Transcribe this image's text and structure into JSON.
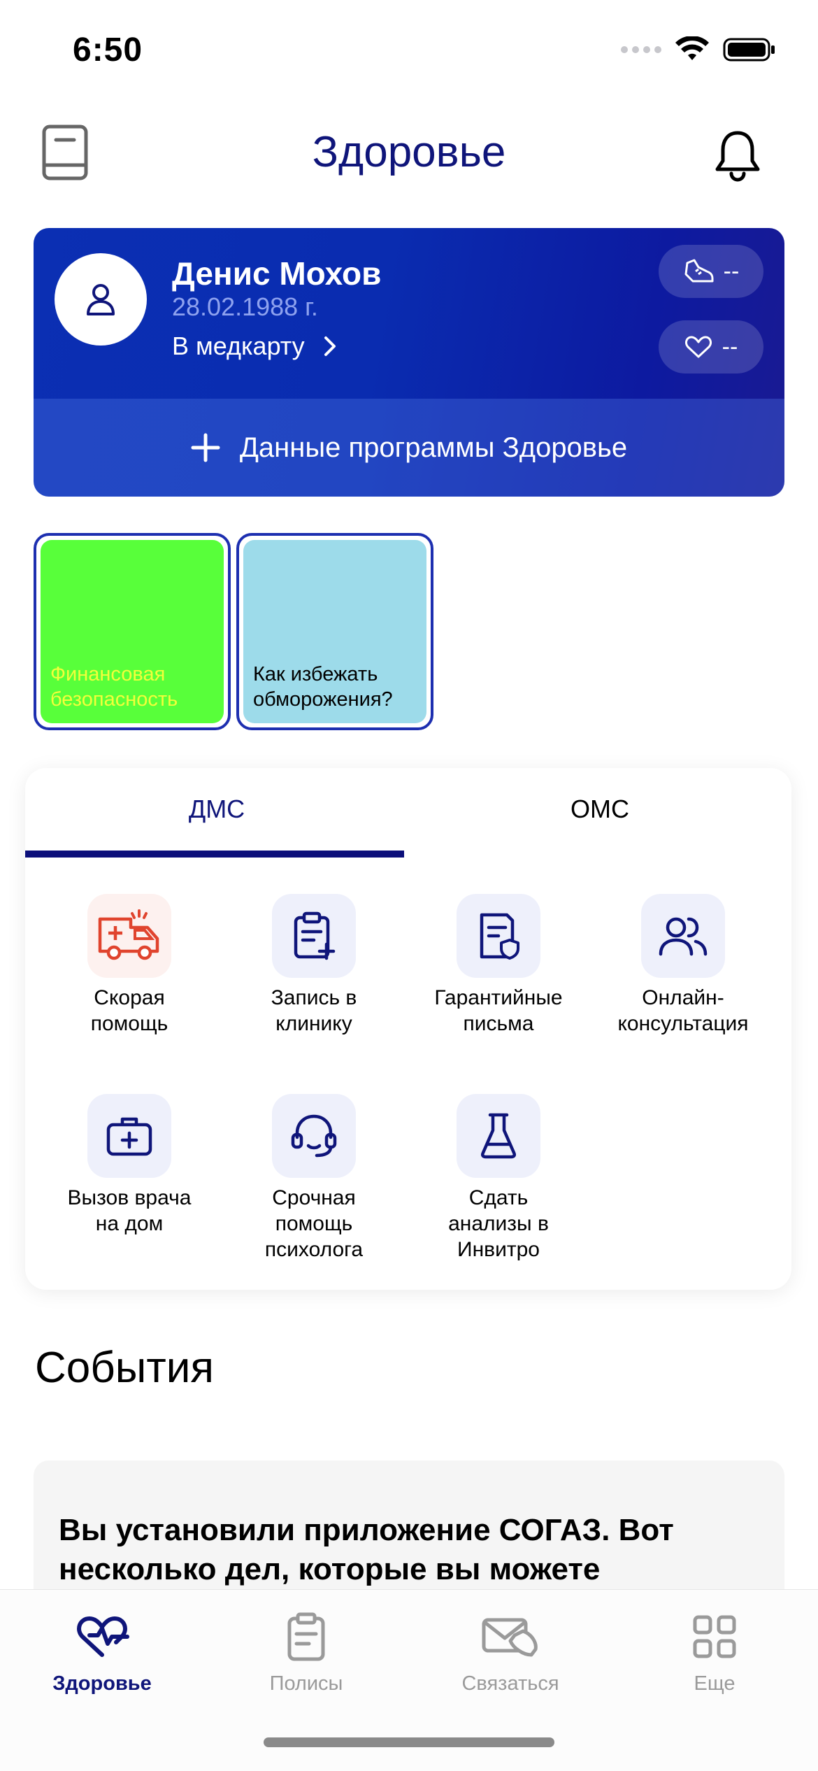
{
  "status_bar": {
    "time": "6:50"
  },
  "header": {
    "title": "Здоровье",
    "left_icon": "book-icon",
    "right_icon": "bell-icon"
  },
  "profile": {
    "name": "Денис Мохов",
    "dob": "28.02.1988 г.",
    "medcard_link": "В медкарту",
    "steps_value": "--",
    "heart_value": "--",
    "add_program_label": "Данные программы Здоровье"
  },
  "stories": [
    {
      "text": "Финансовая безопасность",
      "bg": "#58ff3a",
      "text_color": "#f2ff3a"
    },
    {
      "text": "Как избежать обморожения?",
      "bg": "#9ddbea",
      "text_color": "#000000"
    }
  ],
  "services": {
    "tabs": [
      {
        "label": "ДМС",
        "active": true
      },
      {
        "label": "ОМС",
        "active": false
      }
    ],
    "items": [
      {
        "label": "Скорая помощь",
        "icon": "ambulance-icon"
      },
      {
        "label": "Запись в клинику",
        "icon": "clipboard-plus-icon"
      },
      {
        "label": "Гарантийные письма",
        "icon": "document-shield-icon"
      },
      {
        "label": "Онлайн-консультация",
        "icon": "users-icon"
      },
      {
        "label": "Вызов врача на дом",
        "icon": "medkit-icon"
      },
      {
        "label": "Срочная помощь психолога",
        "icon": "headset-icon"
      },
      {
        "label": "Сдать анализы в Инвитро",
        "icon": "flask-icon"
      }
    ]
  },
  "events": {
    "title": "События",
    "card_text": "Вы установили приложение СОГАЗ. Вот несколько дел, которые вы можете"
  },
  "tab_bar": [
    {
      "label": "Здоровье",
      "icon": "heart-pulse-icon",
      "active": true
    },
    {
      "label": "Полисы",
      "icon": "clipboard-icon",
      "active": false
    },
    {
      "label": "Связаться",
      "icon": "mail-phone-icon",
      "active": false
    },
    {
      "label": "Еще",
      "icon": "grid-icon",
      "active": false
    }
  ],
  "colors": {
    "brand": "#0f157a",
    "card_blue": "#0a2cb0",
    "ambulance_red": "#e0442e"
  }
}
